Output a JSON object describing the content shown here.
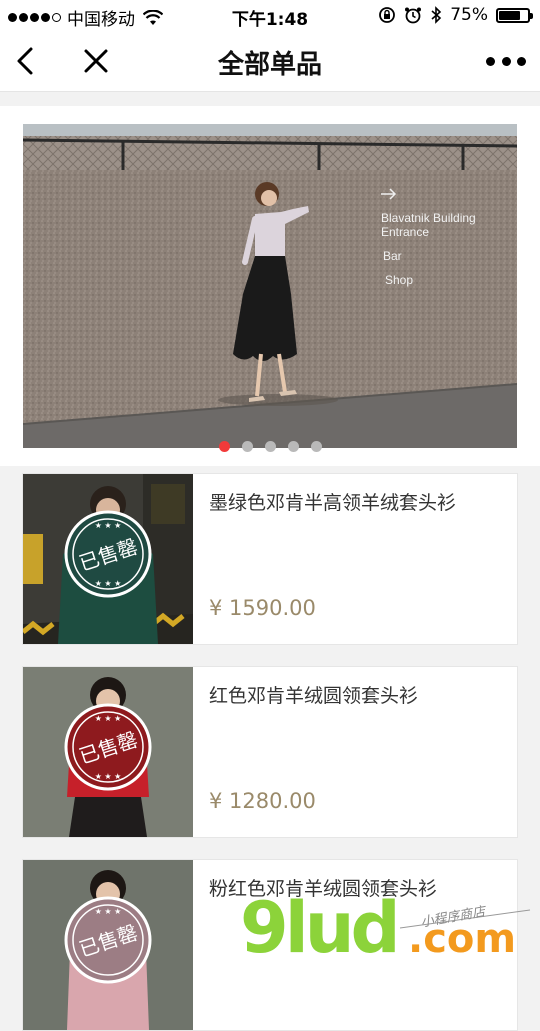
{
  "status_bar": {
    "carrier": "中国移动",
    "time": "下午1:48",
    "battery_text": "75%",
    "battery_level": 0.75,
    "icons": [
      "signal-dots-icon",
      "wifi-icon",
      "rotation-lock-icon",
      "alarm-icon",
      "bluetooth-icon",
      "battery-icon"
    ]
  },
  "nav": {
    "title": "全部单品",
    "back_icon": "chevron-left-icon",
    "close_icon": "close-icon",
    "more_icon": "more-dots-icon"
  },
  "banner": {
    "sign_lines": [
      "Blavatnik Building",
      "Entrance",
      "Bar",
      "Shop"
    ],
    "carousel_dot_count": 5,
    "active_dot": 0,
    "colors": {
      "active_dot": "#f23a3a",
      "dot": "#b9b9b9"
    }
  },
  "products": [
    {
      "name": "墨绿色邓肯半高领羊绒套头衫",
      "price": "¥ 1590.00",
      "sold_stamp": "已售罄",
      "stamp_color": "#1f4a42",
      "sweater_color": "#1d4d40"
    },
    {
      "name": "红色邓肯羊绒圆领套头衫",
      "price": "¥ 1280.00",
      "sold_stamp": "已售罄",
      "stamp_color": "#8e1a1e",
      "sweater_color": "#c6202a"
    },
    {
      "name": "粉红色邓肯羊绒圆领套头衫",
      "price": "",
      "sold_stamp": "已售罄",
      "stamp_color": "#9c7d84",
      "sweater_color": "#d9a6ad"
    }
  ],
  "watermark": {
    "logo": "9lud",
    "domain": ".com",
    "tagline": "小程序商店"
  },
  "colors": {
    "price": "#9a8a6a",
    "logo_green": "#8cd33a",
    "logo_orange": "#f39a1e"
  }
}
